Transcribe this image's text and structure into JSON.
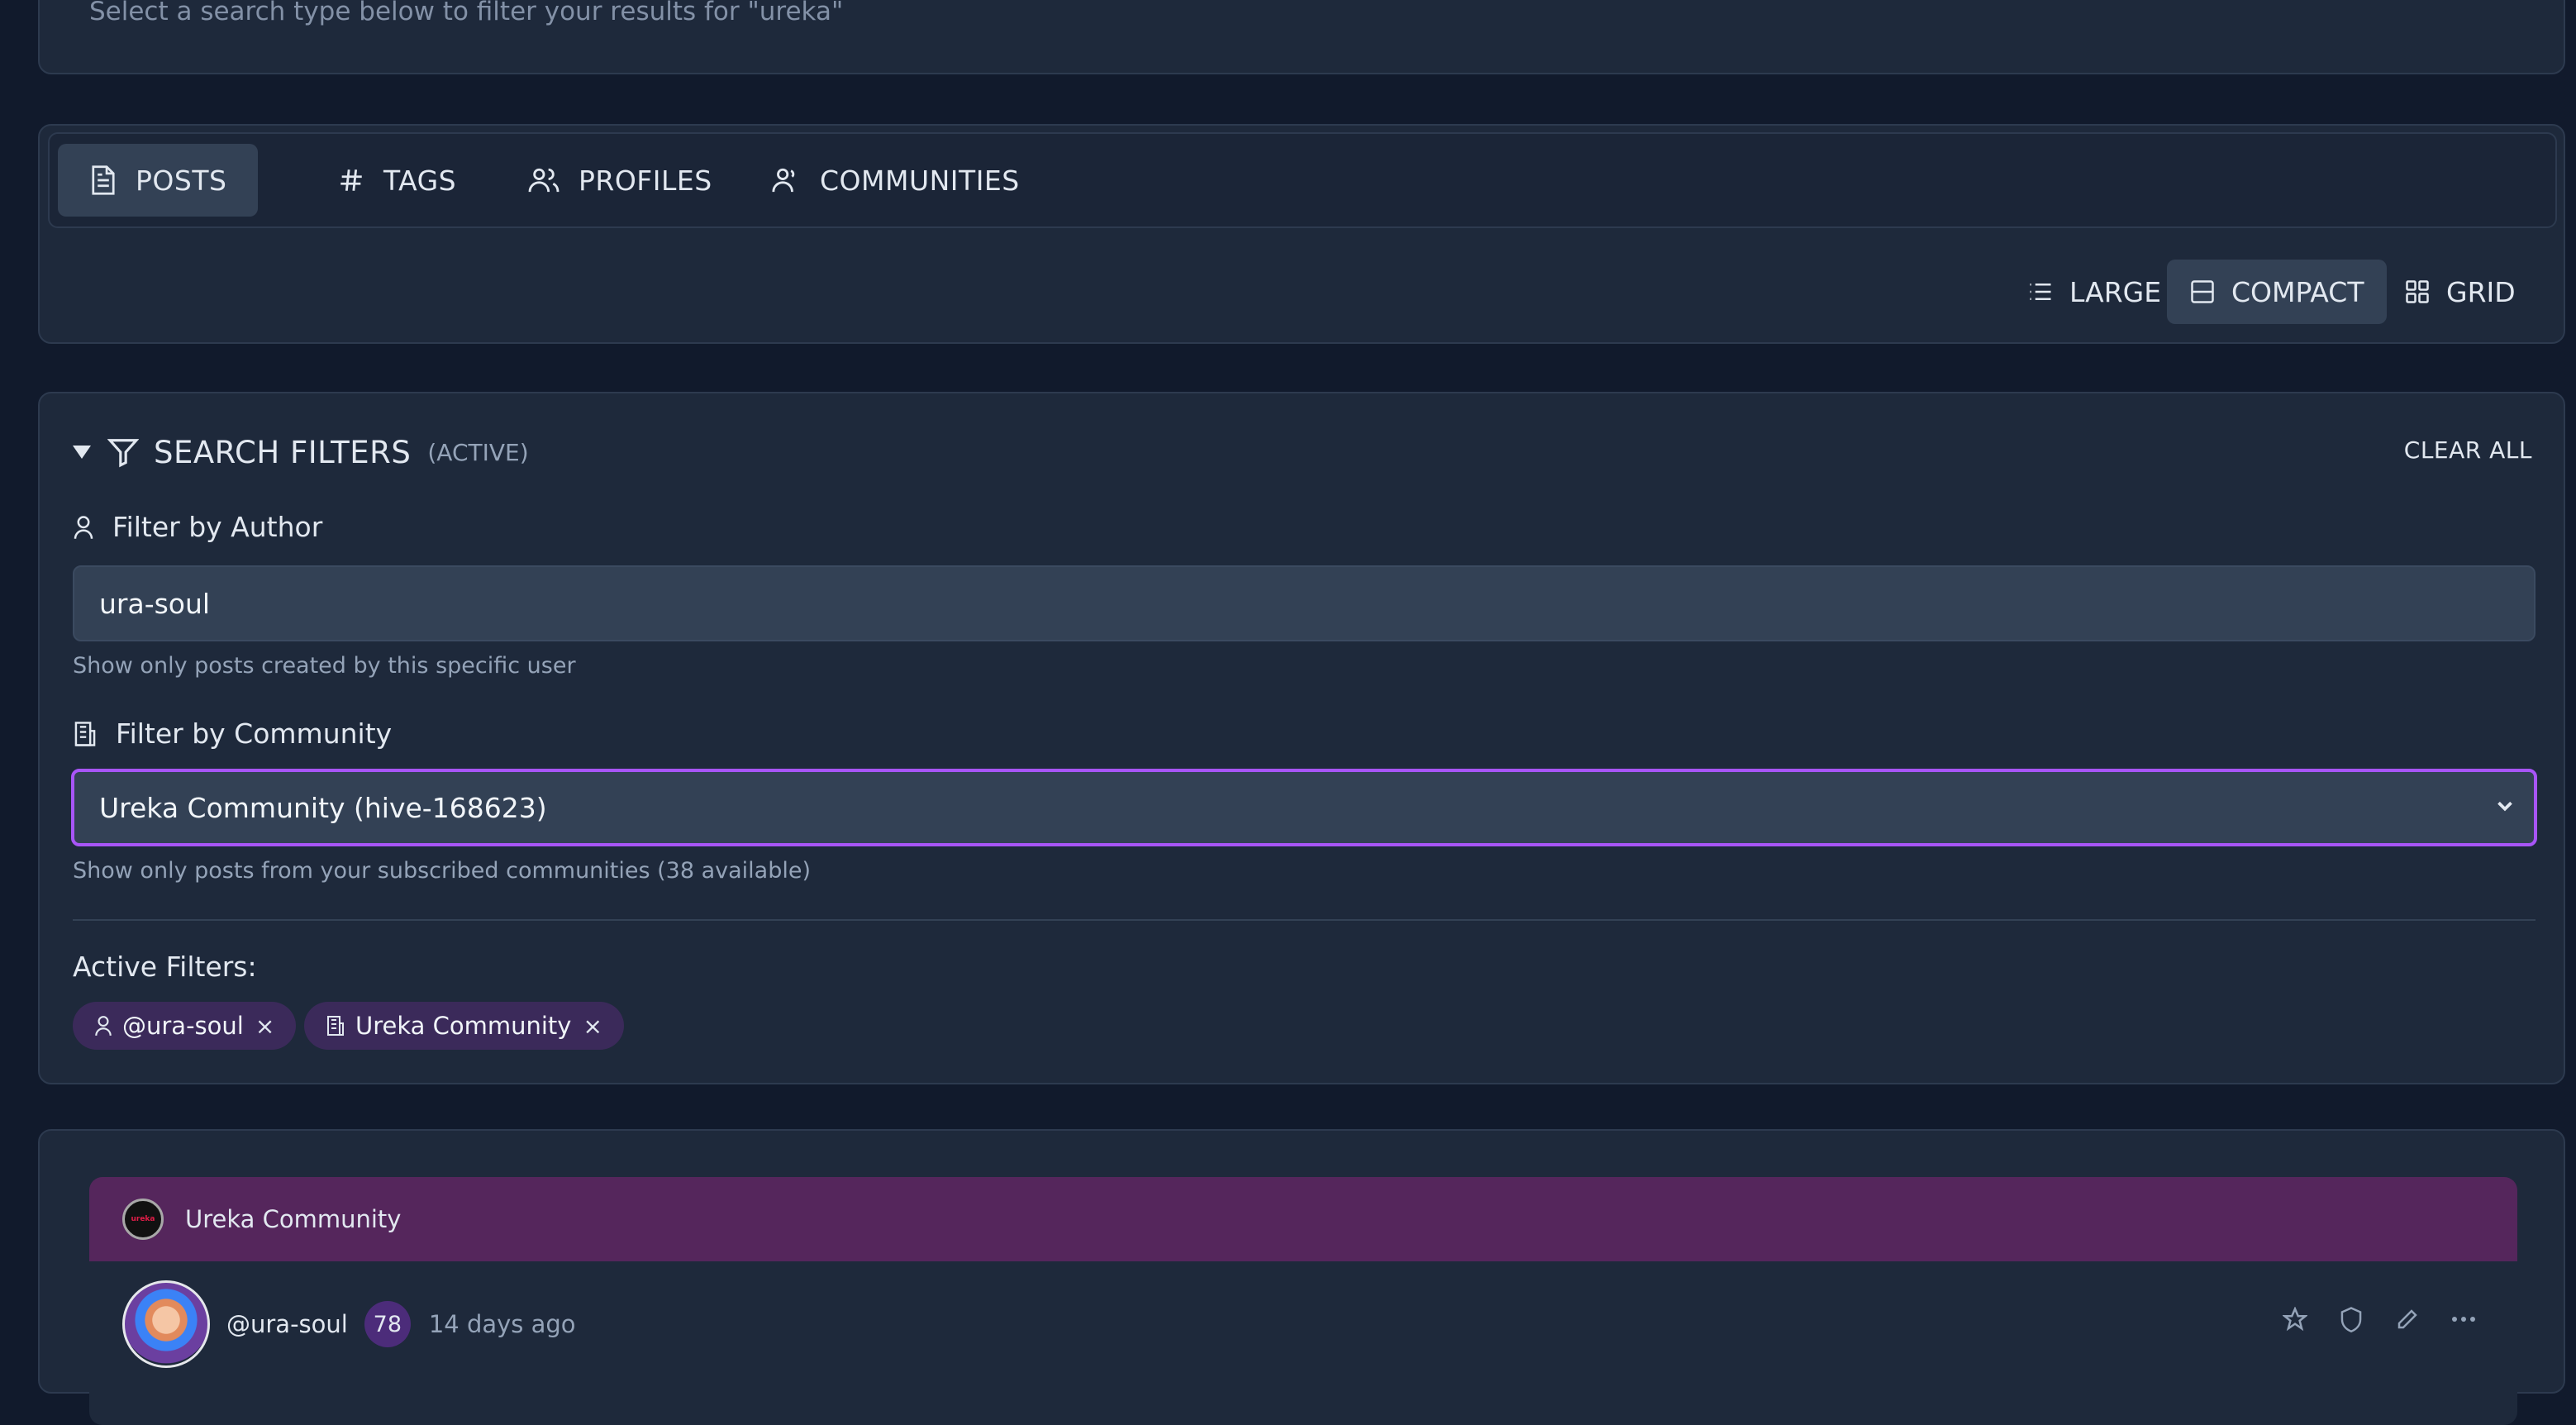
{
  "header": {
    "hint": "Select a search type below to filter your results for \"ureka\""
  },
  "search_types": {
    "tabs": [
      {
        "label": "POSTS",
        "icon": "document-icon",
        "active": true
      },
      {
        "label": "TAGS",
        "icon": "hash-icon",
        "active": false
      },
      {
        "label": "PROFILES",
        "icon": "users-icon",
        "active": false
      },
      {
        "label": "COMMUNITIES",
        "icon": "community-icon",
        "active": false
      }
    ],
    "views": [
      {
        "label": "LARGE",
        "icon": "list-icon",
        "active": false
      },
      {
        "label": "COMPACT",
        "icon": "compact-icon",
        "active": true
      },
      {
        "label": "GRID",
        "icon": "grid-icon",
        "active": false
      }
    ]
  },
  "filters": {
    "title": "SEARCH FILTERS",
    "status": "(ACTIVE)",
    "clear_all": "CLEAR ALL",
    "author": {
      "label": "Filter by Author",
      "value": "ura-soul",
      "help": "Show only posts created by this specific user"
    },
    "community": {
      "label": "Filter by Community",
      "selected": "Ureka Community (hive-168623)",
      "help": "Show only posts from your subscribed communities (38 available)"
    },
    "active_label": "Active Filters:",
    "chips": [
      {
        "label": "@ura-soul",
        "icon": "user-icon",
        "remove": "×"
      },
      {
        "label": "Ureka Community",
        "icon": "community-icon",
        "remove": "×"
      }
    ]
  },
  "post": {
    "community": "Ureka Community",
    "community_avatar_text": "ureka",
    "author": "@ura-soul",
    "reputation": "78",
    "time": "14 days ago"
  },
  "colors": {
    "background": "#111a2c",
    "card": "#1e293b",
    "accent": "#a855f7",
    "community_band": "#55265c",
    "chip": "#3b2a5a"
  }
}
